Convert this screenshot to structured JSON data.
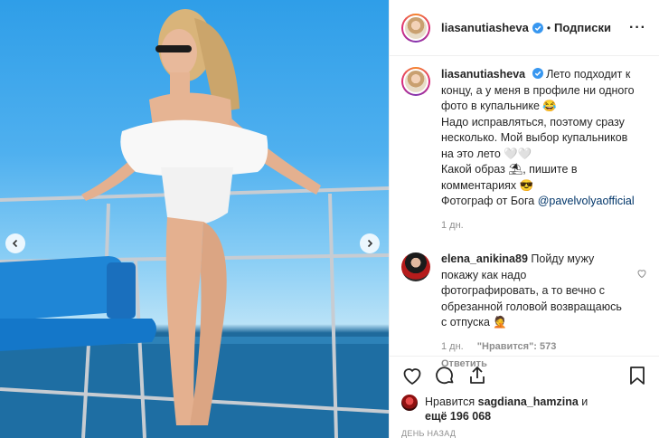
{
  "post": {
    "username": "liasanutiasheva",
    "separator": "•",
    "follow_label": "Подписки",
    "more_label": "···"
  },
  "caption": {
    "username": "liasanutiasheva",
    "line1": "Лето подходит к концу, а у меня в профиле ни одного фото в купальнике 😂",
    "line2": "Надо исправляться, поэтому сразу несколько. Мой выбор купальников на это лето 🤍🤍",
    "line3": "Какой образ ⛱, пишите в комментариях 😎",
    "photographer_prefix": "Фотограф от Бога ",
    "mention": "@pavelvolyaofficial",
    "time": "1 дн."
  },
  "comment": {
    "username": "elena_anikina89",
    "text": "Пойду мужу покажу как надо фотографировать, а то вечно с обрезанной головой возвращаюсь с отпуска 🤦",
    "time": "1 дн.",
    "likes": "\"Нравится\": 573",
    "reply": "Ответить"
  },
  "likes": {
    "prefix": "Нравится ",
    "user": "sagdiana_hamzina",
    "and": " и",
    "others": "ещё 196 068"
  },
  "date_label": "ДЕНЬ НАЗАД",
  "icons": [
    "heart-icon",
    "comment-icon",
    "share-icon",
    "bookmark-icon",
    "verified-icon",
    "chevron-left-icon",
    "chevron-right-icon"
  ],
  "colors": {
    "verified": "#3897f0",
    "link": "#003569",
    "muted": "#8e8e8e"
  }
}
